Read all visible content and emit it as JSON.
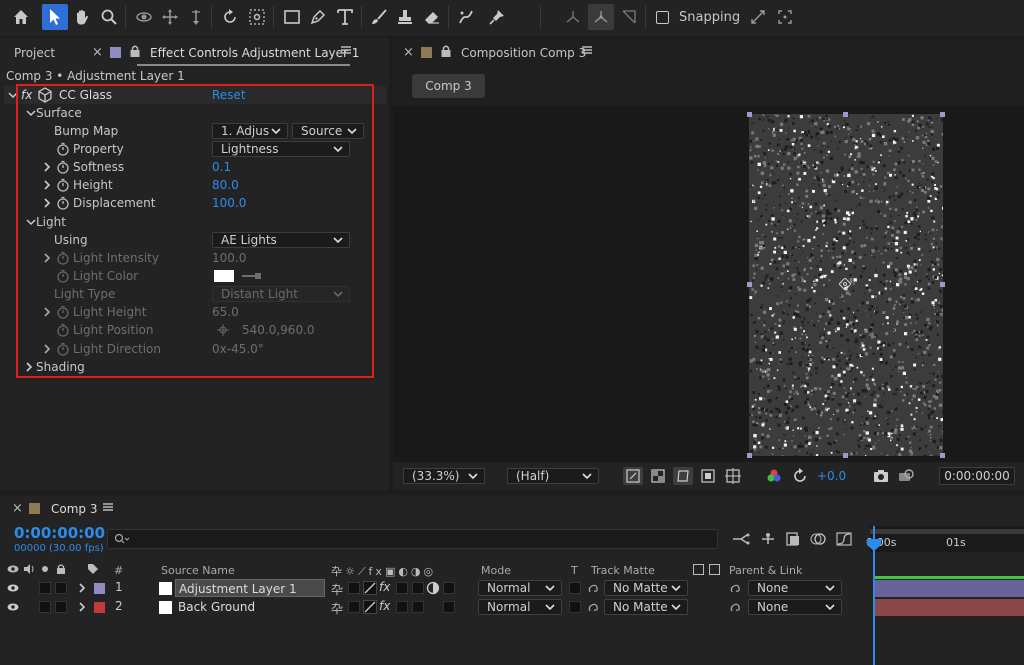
{
  "toolbar": {
    "tools": [
      "home-icon",
      "selection-tool-icon",
      "hand-tool-icon",
      "zoom-tool-icon",
      "orbit-camera-icon",
      "pan-camera-icon",
      "dolly-camera-icon",
      "rotate-tool-icon",
      "anchor-point-tool-icon",
      "rectangle-tool-icon",
      "pen-tool-icon",
      "type-tool-icon",
      "brush-tool-icon",
      "clone-stamp-tool-icon",
      "eraser-tool-icon",
      "roto-brush-tool-icon",
      "puppet-pin-tool-icon"
    ],
    "snapping_label": "Snapping"
  },
  "effect_panel": {
    "tab_project": "Project",
    "tab_effect_controls": "Effect Controls Adjustment Layer 1",
    "breadcrumb": "Comp 3 • Adjustment Layer 1",
    "fx_badge": "fx",
    "effect_name": "CC Glass",
    "reset_label": "Reset",
    "surface_label": "Surface",
    "bump_map_label": "Bump Map",
    "bump_map_value": "1. Adjus",
    "bump_map_source": "Source",
    "property_label": "Property",
    "property_value": "Lightness",
    "softness_label": "Softness",
    "softness_value": "0.1",
    "height_label": "Height",
    "height_value": "80.0",
    "displacement_label": "Displacement",
    "displacement_value": "100.0",
    "light_label": "Light",
    "using_label": "Using",
    "using_value": "AE Lights",
    "light_intensity_label": "Light Intensity",
    "light_intensity_value": "100.0",
    "light_color_label": "Light Color",
    "light_color_value": "#ffffff",
    "light_type_label": "Light Type",
    "light_type_value": "Distant Light",
    "light_height_label": "Light Height",
    "light_height_value": "65.0",
    "light_position_label": "Light Position",
    "light_position_value": "540.0,960.0",
    "light_direction_label": "Light Direction",
    "light_direction_value": "0x-45.0°",
    "shading_label": "Shading"
  },
  "comp_panel": {
    "tab_label": "Composition Comp 3",
    "sub_tab": "Comp 3",
    "zoom_value": "(33.3%)",
    "resolution_value": "(Half)",
    "exposure_value": "+0.0",
    "timecode": "0:00:00:00"
  },
  "timeline": {
    "tab_label": "Comp 3",
    "current_time": "0:00:00:00",
    "frame_info": "00000 (30.00 fps)",
    "search_placeholder": "",
    "ruler_start": "0:00s",
    "ruler_1s": "01s",
    "col_hash": "#",
    "col_source_name": "Source Name",
    "col_mode": "Mode",
    "col_t": "T",
    "col_track_matte": "Track Matte",
    "col_parent": "Parent & Link",
    "layers": [
      {
        "index": "1",
        "name": "Adjustment Layer 1",
        "label_color": "#8f8cc4",
        "mode": "Normal",
        "matte": "No Matte",
        "parent": "None"
      },
      {
        "index": "2",
        "name": "Back Ground",
        "label_color": "#c23a3a",
        "mode": "Normal",
        "matte": "No Matte",
        "parent": "None"
      }
    ]
  },
  "colors": {
    "accent_blue": "#2d8ceb",
    "highlight_red": "#e01e1e",
    "adjustment_bar": "#66639a",
    "background_bar": "#8a4648"
  }
}
